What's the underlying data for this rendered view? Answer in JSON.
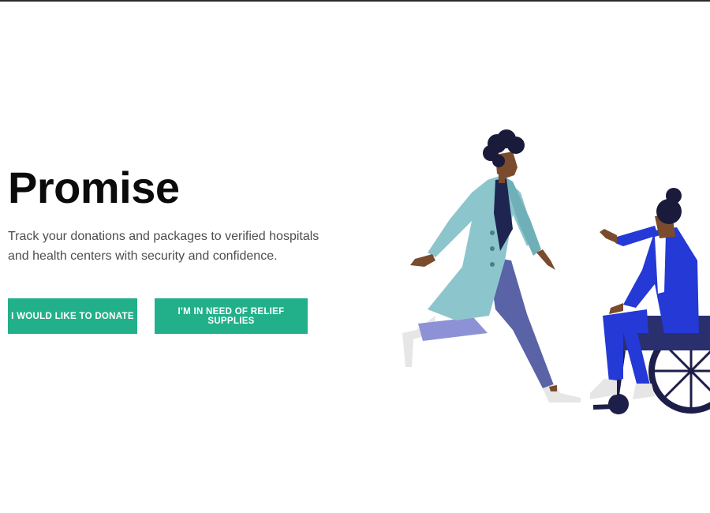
{
  "hero": {
    "title": "Promise",
    "subtitle": "Track your donations and packages to verified hospitals and health centers with security and confidence."
  },
  "actions": {
    "donate_label": "I WOULD LIKE TO DONATE",
    "relief_label": "I'M IN NEED OF RELIEF SUPPLIES"
  },
  "colors": {
    "accent": "#22b08a",
    "title_text": "#0b0b0b",
    "body_text": "#4d4d4d",
    "coat": "#8cc6cc",
    "trousers": "#5a63a6",
    "wheelchair_person": "#2439d6",
    "wheelchair": "#1e1e4a"
  },
  "illustration": {
    "name": "doctor-and-wheelchair-user-illustration"
  }
}
